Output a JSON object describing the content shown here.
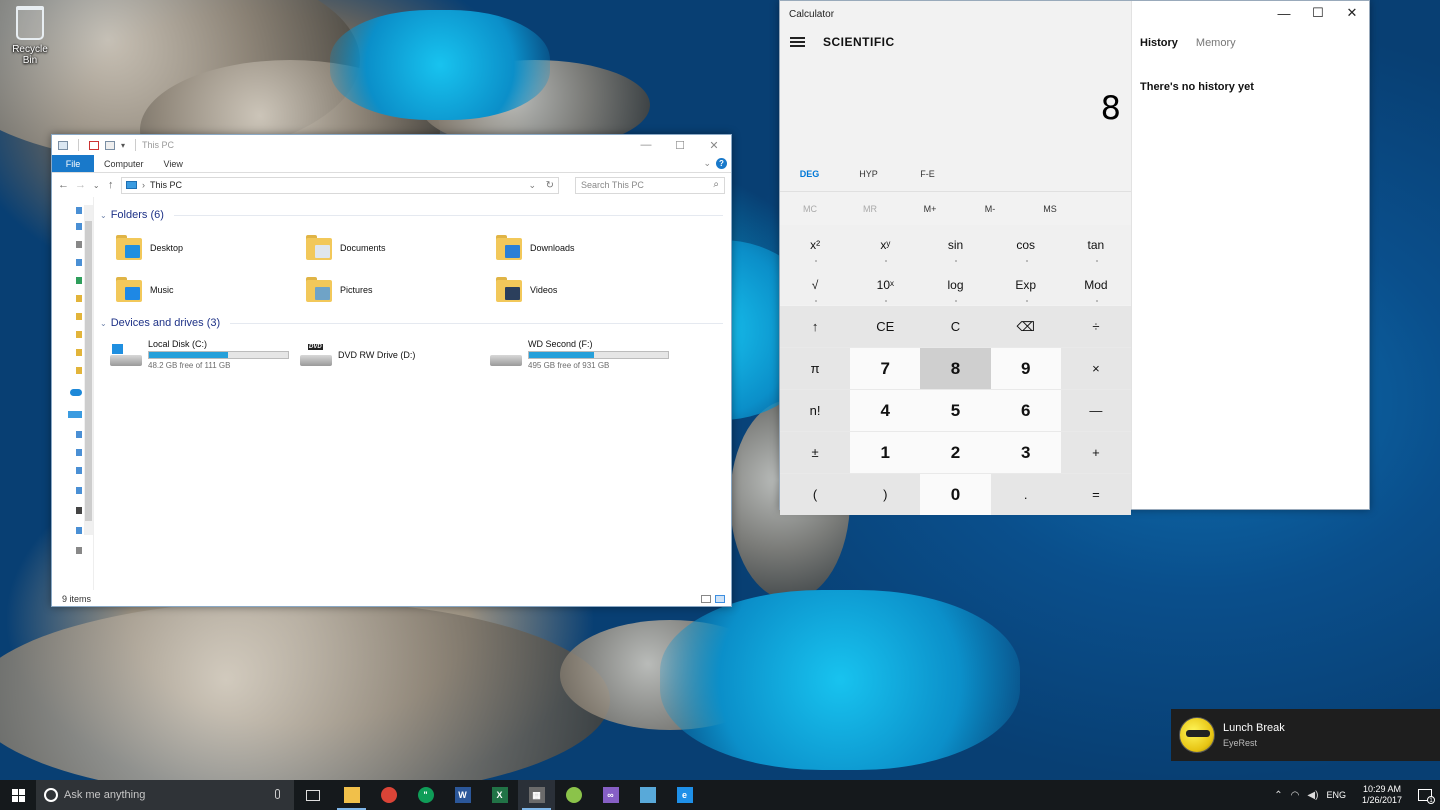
{
  "desktop": {
    "icons": [
      {
        "label": "Recycle Bin"
      }
    ]
  },
  "explorer": {
    "title": "This PC",
    "ribbon_tabs": [
      "File",
      "Computer",
      "View"
    ],
    "address": "This PC",
    "search_placeholder": "Search This PC",
    "folders_header": "Folders (6)",
    "folders": [
      {
        "name": "Desktop",
        "icon": "desktop-folder-icon",
        "badge_color": "#1f8fe0"
      },
      {
        "name": "Documents",
        "icon": "documents-folder-icon",
        "badge_color": "#dfe6ee"
      },
      {
        "name": "Downloads",
        "icon": "downloads-folder-icon",
        "badge_color": "#2a7fd6"
      },
      {
        "name": "Music",
        "icon": "music-folder-icon",
        "badge_color": "#1e88e5"
      },
      {
        "name": "Pictures",
        "icon": "pictures-folder-icon",
        "badge_color": "#6fa3c7"
      },
      {
        "name": "Videos",
        "icon": "videos-folder-icon",
        "badge_color": "#2b3f5c"
      }
    ],
    "drives_header": "Devices and drives (3)",
    "drives": [
      {
        "name": "Local Disk (C:)",
        "free": "48.2 GB free of 111 GB",
        "used_fraction": 0.57,
        "icon": "windows-drive-icon",
        "has_bar": true
      },
      {
        "name": "DVD RW Drive (D:)",
        "free": "",
        "used_fraction": 0,
        "icon": "dvd-drive-icon",
        "has_bar": false
      },
      {
        "name": "WD Second (F:)",
        "free": "495 GB free of 931 GB",
        "used_fraction": 0.47,
        "icon": "hard-drive-icon",
        "has_bar": true
      }
    ],
    "status": "9 items"
  },
  "calculator": {
    "title": "Calculator",
    "mode": "SCIENTIFIC",
    "display": "8",
    "angle": [
      "DEG",
      "HYP",
      "F-E"
    ],
    "memory": [
      "MC",
      "MR",
      "M+",
      "M-",
      "MS"
    ],
    "sci_keys": [
      "x²",
      "xʸ",
      "sin",
      "cos",
      "tan",
      "√",
      "10ˣ",
      "log",
      "Exp",
      "Mod"
    ],
    "keys": [
      "↑",
      "CE",
      "C",
      "⌫",
      "÷",
      "π",
      "7",
      "8",
      "9",
      "×",
      "n!",
      "4",
      "5",
      "6",
      "—",
      "±",
      "1",
      "2",
      "3",
      "+",
      "(",
      ")",
      "0",
      ".",
      "="
    ],
    "pressed_key": "8",
    "history_tabs": [
      "History",
      "Memory"
    ],
    "history_empty": "There's no history yet"
  },
  "toast": {
    "title": "Lunch Break",
    "app": "EyeRest"
  },
  "taskbar": {
    "search_placeholder": "Ask me anything",
    "apps": [
      {
        "name": "file-explorer-icon",
        "color": "#f1c04a",
        "label": ""
      },
      {
        "name": "chrome-icon",
        "color": "#db4437",
        "label": ""
      },
      {
        "name": "hangouts-icon",
        "color": "#0f9d58",
        "label": "\""
      },
      {
        "name": "word-icon",
        "color": "#2b579a",
        "label": "W"
      },
      {
        "name": "excel-icon",
        "color": "#217346",
        "label": "X"
      },
      {
        "name": "calculator-icon",
        "color": "#6b6b6b",
        "label": "▦"
      },
      {
        "name": "android-icon",
        "color": "#8bc34a",
        "label": ""
      },
      {
        "name": "visual-studio-icon",
        "color": "#865fc5",
        "label": "∞"
      },
      {
        "name": "tool-icon",
        "color": "#58a9d9",
        "label": ""
      },
      {
        "name": "edge-icon",
        "color": "#1e90e8",
        "label": "e"
      }
    ],
    "lang": "ENG",
    "time": "10:29 AM",
    "date": "1/26/2017",
    "notifications": "1"
  }
}
